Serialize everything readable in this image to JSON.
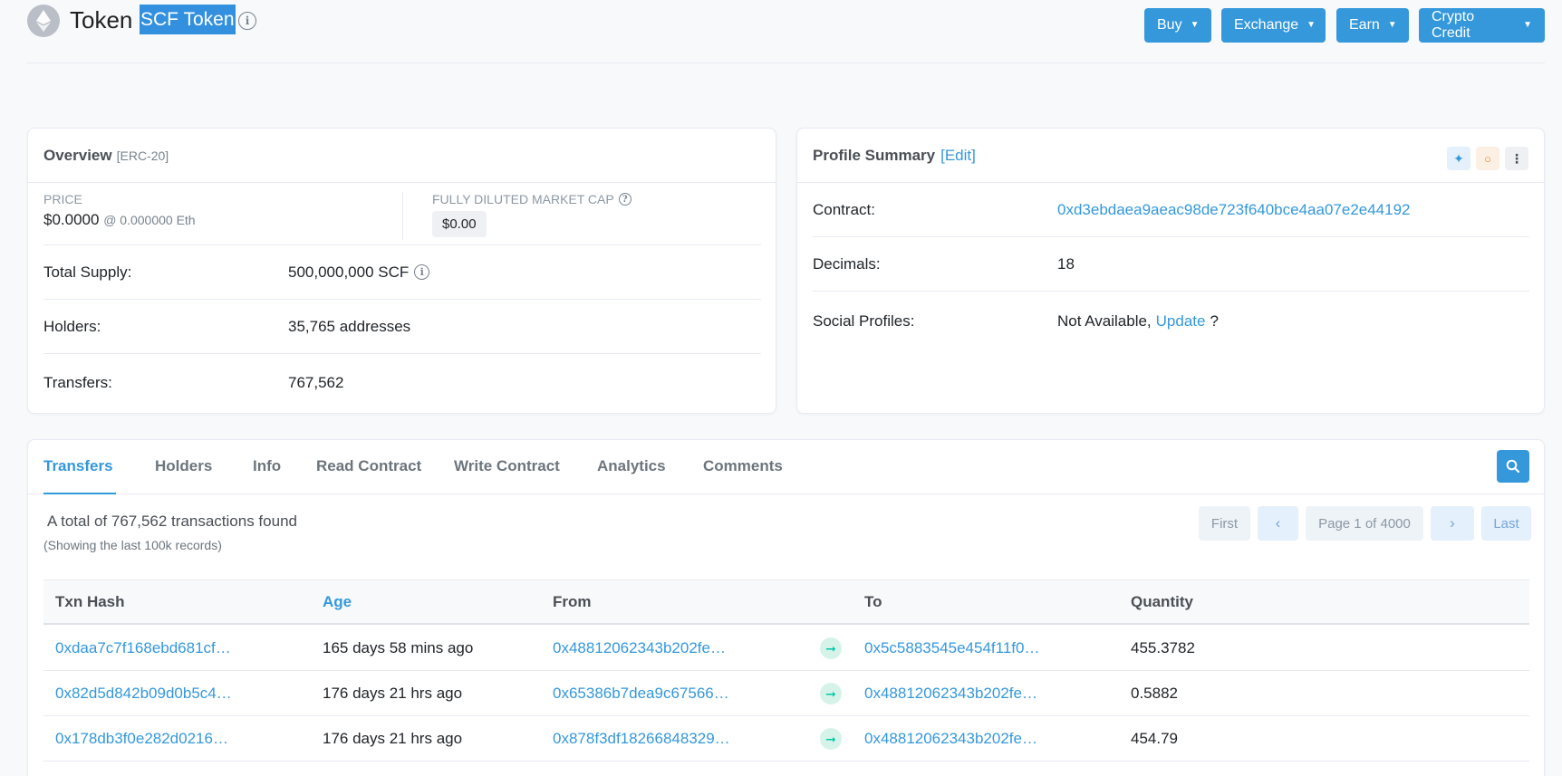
{
  "header": {
    "token_label": "Token",
    "token_name": "SCF Token",
    "buttons": [
      {
        "label": "Buy"
      },
      {
        "label": "Exchange"
      },
      {
        "label": "Earn"
      },
      {
        "label": "Crypto Credit"
      }
    ]
  },
  "overview": {
    "title": "Overview",
    "standard": "[ERC-20]",
    "price_label": "PRICE",
    "price_value": "$0.0000",
    "price_eth": "@ 0.000000 Eth",
    "mcap_label": "FULLY DILUTED MARKET CAP",
    "mcap_value": "$0.00",
    "rows": [
      {
        "label": "Total Supply:",
        "value": "500,000,000 SCF"
      },
      {
        "label": "Holders:",
        "value": "35,765 addresses"
      },
      {
        "label": "Transfers:",
        "value": "767,562"
      }
    ]
  },
  "profile": {
    "title": "Profile Summary",
    "edit_label": "[Edit]",
    "contract_label": "Contract:",
    "contract_value": "0xd3ebdaea9aeac98de723f640bce4aa07e2e44192",
    "decimals_label": "Decimals:",
    "decimals_value": "18",
    "social_label": "Social Profiles:",
    "social_value": "Not Available,",
    "social_update": "Update",
    "social_q": "?"
  },
  "tabs": [
    "Transfers",
    "Holders",
    "Info",
    "Read Contract",
    "Write Contract",
    "Analytics",
    "Comments"
  ],
  "transfers": {
    "summary": "A total of 767,562 transactions found",
    "sub_summary": "(Showing the last 100k records)",
    "pagination": {
      "first": "First",
      "page": "Page 1 of 4000",
      "last": "Last"
    },
    "columns": [
      "Txn Hash",
      "Age",
      "From",
      "To",
      "Quantity"
    ],
    "rows": [
      {
        "hash": "0xdaa7c7f168ebd681cf…",
        "age": "165 days 58 mins ago",
        "from": "0x48812062343b202fe…",
        "to": "0x5c5883545e454f11f0…",
        "qty": "455.3782"
      },
      {
        "hash": "0x82d5d842b09d0b5c4…",
        "age": "176 days 21 hrs ago",
        "from": "0x65386b7dea9c67566…",
        "to": "0x48812062343b202fe…",
        "qty": "0.5882"
      },
      {
        "hash": "0x178db3f0e282d0216…",
        "age": "176 days 21 hrs ago",
        "from": "0x878f3df18266848329…",
        "to": "0x48812062343b202fe…",
        "qty": "454.79"
      }
    ]
  },
  "colors": {
    "accent": "#3498db",
    "success": "#00c9a7"
  }
}
